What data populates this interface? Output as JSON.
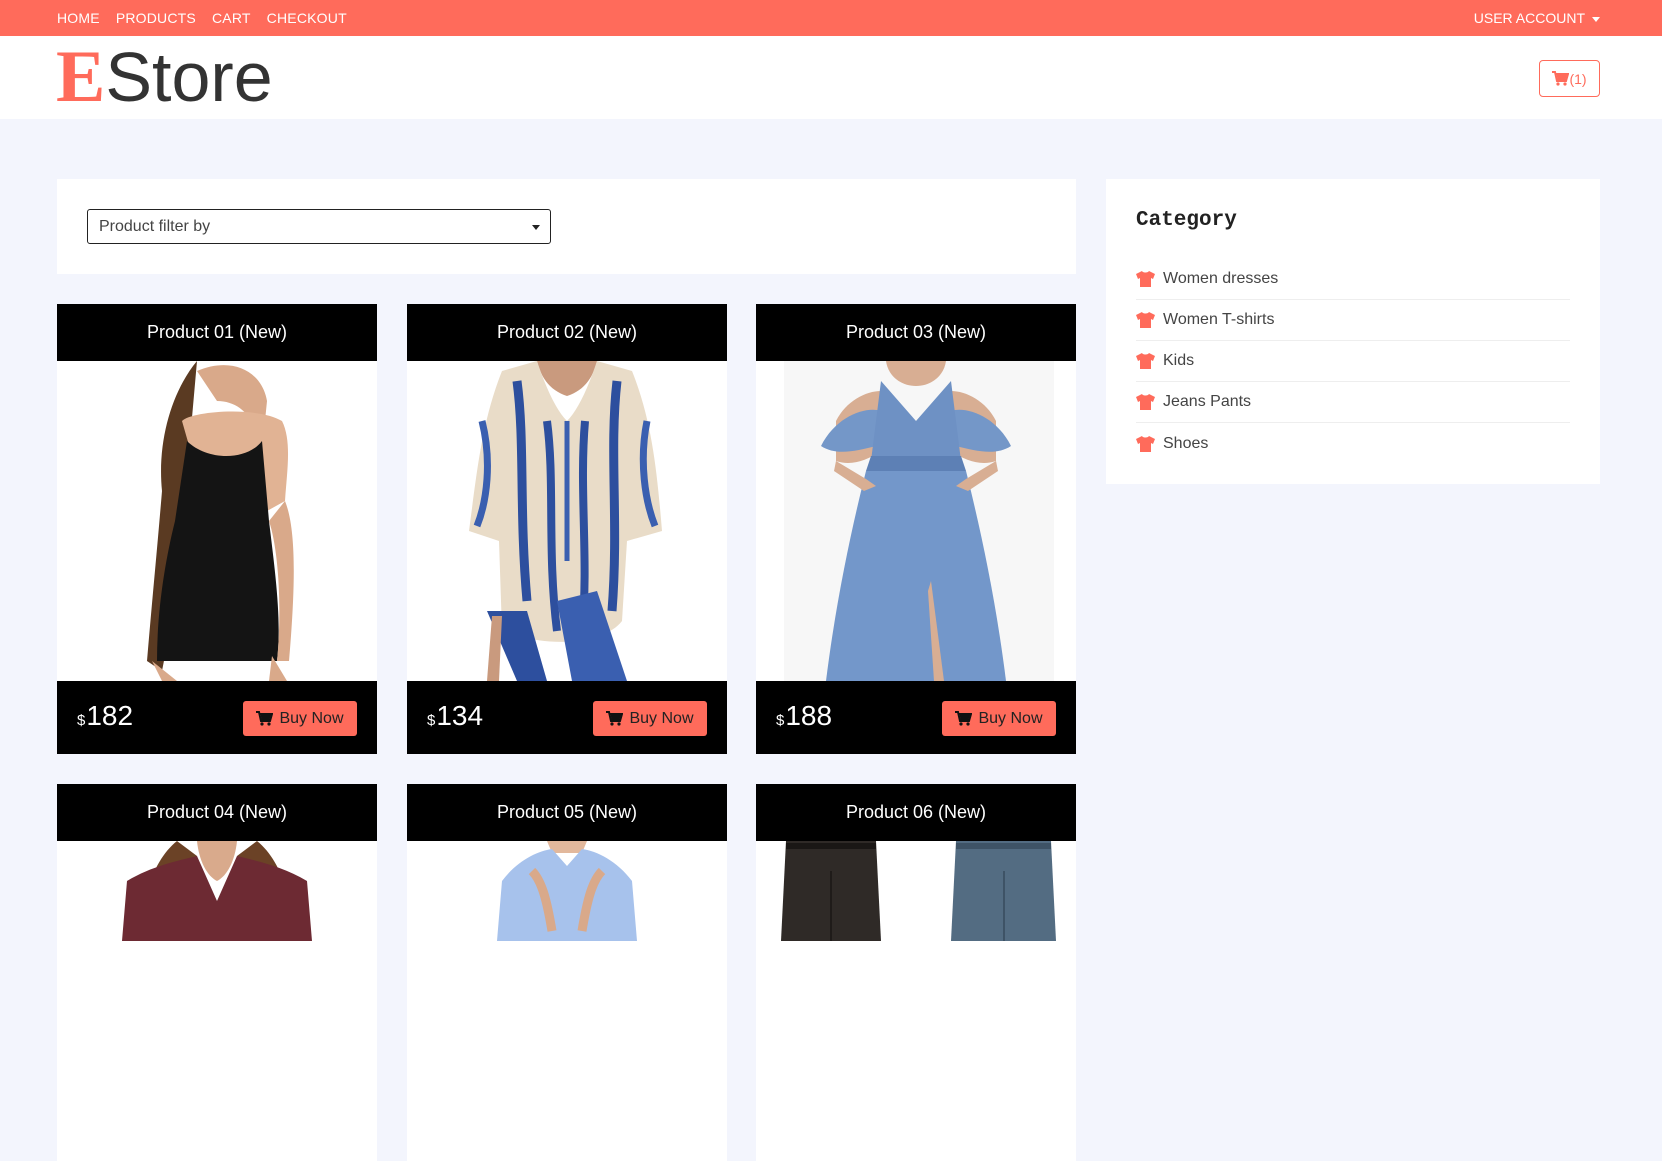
{
  "nav": {
    "links": [
      "HOME",
      "PRODUCTS",
      "CART",
      "CHECKOUT"
    ],
    "user_account": "USER ACCOUNT"
  },
  "brand": {
    "first_letter": "E",
    "rest": "Store",
    "accent_color": "#ff6b5b"
  },
  "cart": {
    "count_label": "(1)"
  },
  "filter": {
    "selected": "Product filter by"
  },
  "products": [
    {
      "title": "Product 01 (New)",
      "currency": "$",
      "price": "182",
      "buy_label": "Buy Now",
      "image": "black-dress"
    },
    {
      "title": "Product 02 (New)",
      "currency": "$",
      "price": "134",
      "buy_label": "Buy Now",
      "image": "tie-dye-tunic"
    },
    {
      "title": "Product 03 (New)",
      "currency": "$",
      "price": "188",
      "buy_label": "Buy Now",
      "image": "blue-gown"
    },
    {
      "title": "Product 04 (New)",
      "image": "burgundy-top"
    },
    {
      "title": "Product 05 (New)",
      "image": "kids-shirt"
    },
    {
      "title": "Product 06 (New)",
      "image": "jeans-pants"
    }
  ],
  "categories": {
    "title": "Category",
    "items": [
      "Women dresses",
      "Women T-shirts",
      "Kids",
      "Jeans Pants",
      "Shoes"
    ]
  }
}
